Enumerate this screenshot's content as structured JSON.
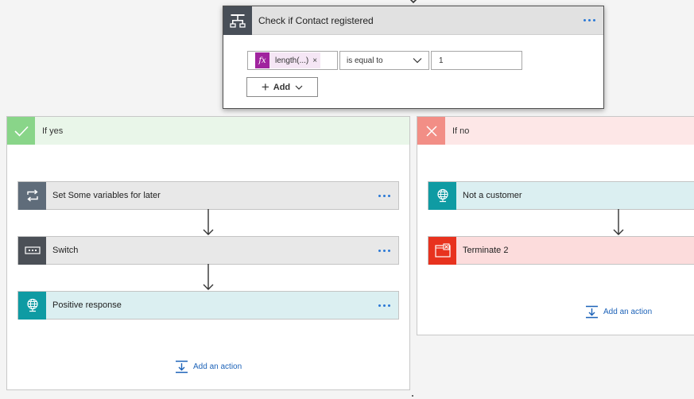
{
  "condition": {
    "title": "Check if Contact registered",
    "icon": "condition-icon",
    "expression_token": "length(...)",
    "token_remove": "×",
    "operator": "is equal to",
    "value": "1",
    "add_label": "Add"
  },
  "branch_yes": {
    "title": "If yes",
    "icon": "checkmark-icon",
    "color": "#89d589",
    "actions": [
      {
        "title": "Set Some variables for later",
        "icon": "loop-icon"
      },
      {
        "title": "Switch",
        "icon": "switch-icon"
      },
      {
        "title": "Positive response",
        "icon": "globe-icon"
      }
    ],
    "add_action": "Add an action"
  },
  "branch_no": {
    "title": "If no",
    "icon": "close-icon",
    "color": "#f28e86",
    "actions": [
      {
        "title": "Not a customer",
        "icon": "globe-icon"
      },
      {
        "title": "Terminate 2",
        "icon": "terminate-icon"
      }
    ],
    "add_action": "Add an action"
  },
  "colors": {
    "link": "#1c62b8",
    "expression_token": "#a0249e",
    "dots": "#2b79d6"
  }
}
